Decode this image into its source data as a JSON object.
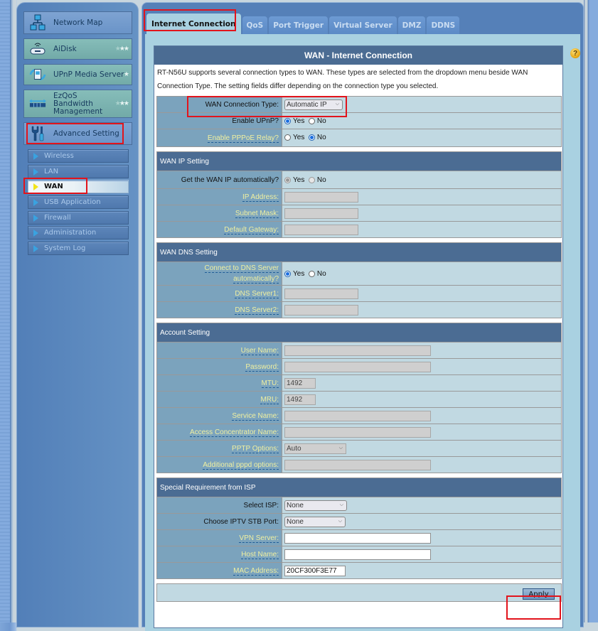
{
  "sidebar": {
    "main_items": [
      {
        "label": "Network Map",
        "icon": "network-map-icon"
      },
      {
        "label": "AiDisk",
        "icon": "aidisk-icon"
      },
      {
        "label": "UPnP Media Server",
        "icon": "upnp-media-server-icon"
      },
      {
        "label": "EzQoS Bandwidth Management",
        "line1": "EzQoS",
        "line2": "Bandwidth",
        "line3": "Management",
        "icon": "bandwidth-icon"
      },
      {
        "label": "Advanced Setting",
        "icon": "wrench-screwdriver-icon"
      }
    ],
    "sub_items": [
      {
        "label": "Wireless"
      },
      {
        "label": "LAN"
      },
      {
        "label": "WAN",
        "active": true
      },
      {
        "label": "USB Application"
      },
      {
        "label": "Firewall"
      },
      {
        "label": "Administration"
      },
      {
        "label": "System Log"
      }
    ]
  },
  "tabs": [
    {
      "label": "Internet Connection",
      "active": true
    },
    {
      "label": "QoS"
    },
    {
      "label": "Port Trigger"
    },
    {
      "label": "Virtual Server"
    },
    {
      "label": "DMZ"
    },
    {
      "label": "DDNS"
    }
  ],
  "panel": {
    "title": "WAN - Internet Connection",
    "description": "RT-N56U supports several connection types to WAN. These types are selected from the dropdown menu beside WAN Connection Type. The setting fields differ depending on the connection type you selected.",
    "help_icon": "?"
  },
  "basic": {
    "wan_type_label": "WAN Connection Type:",
    "wan_type_value": "Automatic IP",
    "upnp_label": "Enable UPnP?",
    "upnp_value": "Yes",
    "pppoe_relay_label": "Enable PPPoE Relay?",
    "pppoe_relay_value": "No",
    "yes": "Yes",
    "no": "No"
  },
  "wan_ip": {
    "title": "WAN IP Setting",
    "auto_label": "Get the WAN IP automatically?",
    "auto_value": "Yes",
    "ip_label": "IP Address:",
    "ip_value": "",
    "mask_label": "Subnet Mask:",
    "mask_value": "",
    "gateway_label": "Default Gateway:",
    "gateway_value": ""
  },
  "wan_dns": {
    "title": "WAN DNS Setting",
    "auto_label_1": "Connect to DNS Server",
    "auto_label_2": "automatically?",
    "auto_value": "Yes",
    "dns1_label": "DNS Server1:",
    "dns1_value": "",
    "dns2_label": "DNS Server2:",
    "dns2_value": ""
  },
  "account": {
    "title": "Account Setting",
    "username_label": "User Name:",
    "username_value": "",
    "password_label": "Password:",
    "password_value": "",
    "mtu_label": "MTU:",
    "mtu_value": "1492",
    "mru_label": "MRU:",
    "mru_value": "1492",
    "service_label": "Service Name:",
    "service_value": "",
    "ac_label": "Access Concentrator Name:",
    "ac_value": "",
    "pptp_label": "PPTP Options:",
    "pptp_value": "Auto",
    "pppd_label": "Additional pppd options:",
    "pppd_value": ""
  },
  "isp": {
    "title": "Special Requirement from ISP",
    "select_isp_label": "Select ISP:",
    "select_isp_value": "None",
    "iptv_label": "Choose IPTV STB Port:",
    "iptv_value": "None",
    "vpn_label": "VPN Server:",
    "vpn_value": "",
    "host_label": "Host Name:",
    "host_value": "",
    "mac_label": "MAC Address:",
    "mac_value": "20CF300F3E77"
  },
  "actions": {
    "apply_label": "Apply"
  },
  "colors": {
    "highlight_box": "#e2141c",
    "section_header": "#4b6c93",
    "label_cell": "#7ba3bd",
    "value_cell": "#c1d9e2",
    "hint_label_text": "#f0f0a0"
  }
}
